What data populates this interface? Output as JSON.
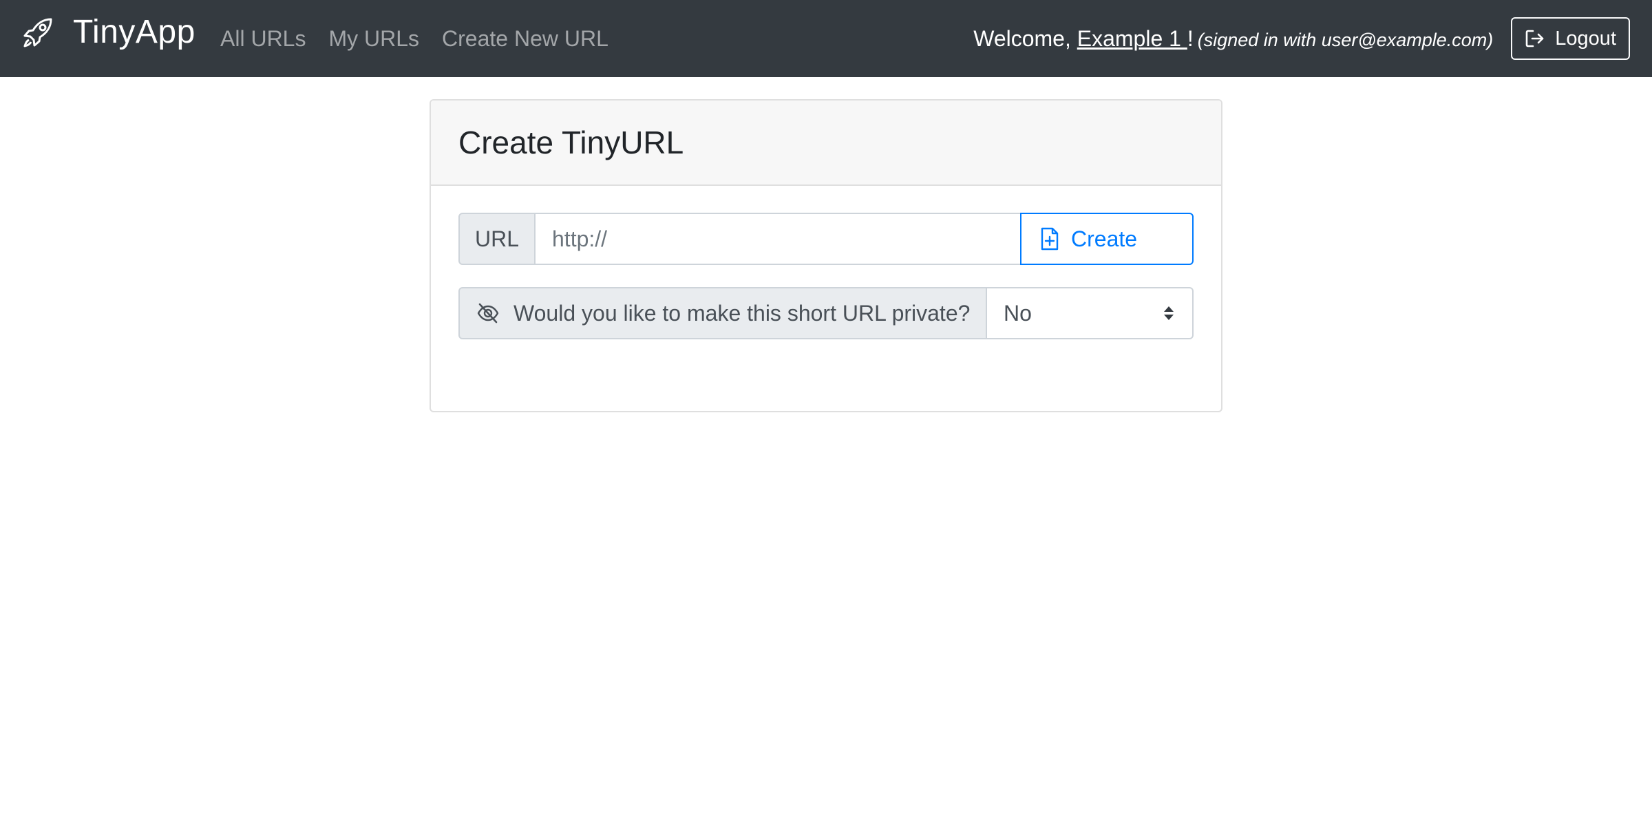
{
  "navbar": {
    "brand": "TinyApp",
    "links": [
      "All URLs",
      "My URLs",
      "Create New URL"
    ],
    "welcome_prefix": "Welcome, ",
    "username": "Example 1 ",
    "welcome_suffix": "!",
    "signed_in": "(signed in with user@example.com)",
    "logout_label": "Logout"
  },
  "card": {
    "title": "Create TinyURL",
    "url_label": "URL",
    "url_placeholder": "http://",
    "url_value": "",
    "create_label": "Create",
    "private_question": "Would you like to make this short URL private?",
    "private_selected": "No"
  },
  "colors": {
    "navbar_bg": "#343a40",
    "primary": "#007bff",
    "addon_bg": "#e9ecef",
    "card_header_bg": "#f7f7f7"
  },
  "icons": {
    "brand": "rocket-icon",
    "logout": "box-arrow-right-icon",
    "create": "file-plus-icon",
    "private": "eye-slash-icon",
    "select": "sort-arrows-icon"
  }
}
